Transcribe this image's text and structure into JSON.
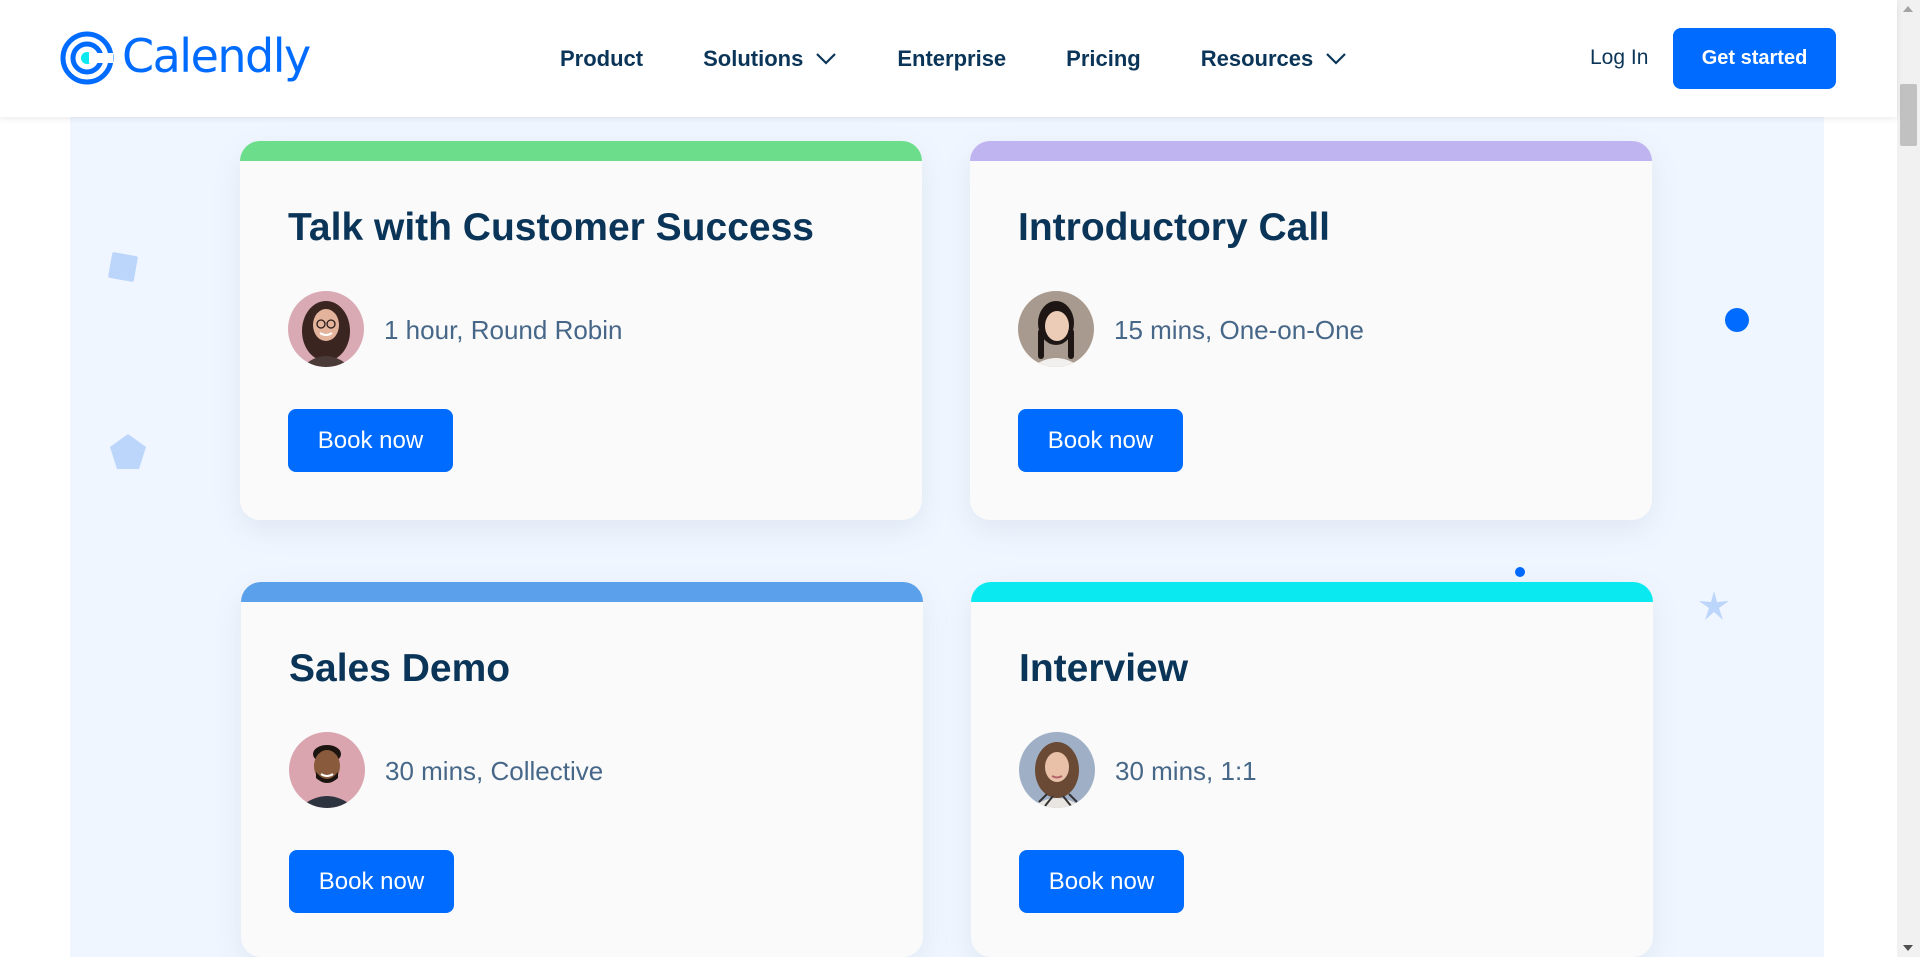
{
  "brand": {
    "name": "Calendly",
    "color": "#006bff"
  },
  "nav": {
    "items": [
      {
        "label": "Product",
        "has_dropdown": false
      },
      {
        "label": "Solutions",
        "has_dropdown": true
      },
      {
        "label": "Enterprise",
        "has_dropdown": false
      },
      {
        "label": "Pricing",
        "has_dropdown": false
      },
      {
        "label": "Resources",
        "has_dropdown": true
      }
    ],
    "login_label": "Log In",
    "cta_label": "Get started"
  },
  "cards": [
    {
      "title": "Talk with Customer Success",
      "meta": "1 hour, Round Robin",
      "button_label": "Book now",
      "accent_color": "#6bdd8b",
      "avatar_icon": "person-avatar-glasses"
    },
    {
      "title": "Introductory Call",
      "meta": "15 mins, One-on-One",
      "button_label": "Book now",
      "accent_color": "#c0b4f0",
      "avatar_icon": "person-avatar-braids"
    },
    {
      "title": "Sales Demo",
      "meta": "30 mins, Collective",
      "button_label": "Book now",
      "accent_color": "#5ba0ea",
      "avatar_icon": "person-avatar-smiling-man"
    },
    {
      "title": "Interview",
      "meta": "30 mins, 1:1",
      "button_label": "Book now",
      "accent_color": "#0ae8f0",
      "avatar_icon": "person-avatar-woman"
    }
  ],
  "colors": {
    "heading": "#0b3558",
    "body": "#476788",
    "button": "#006bff",
    "section_bg": "#f0f6ff"
  }
}
